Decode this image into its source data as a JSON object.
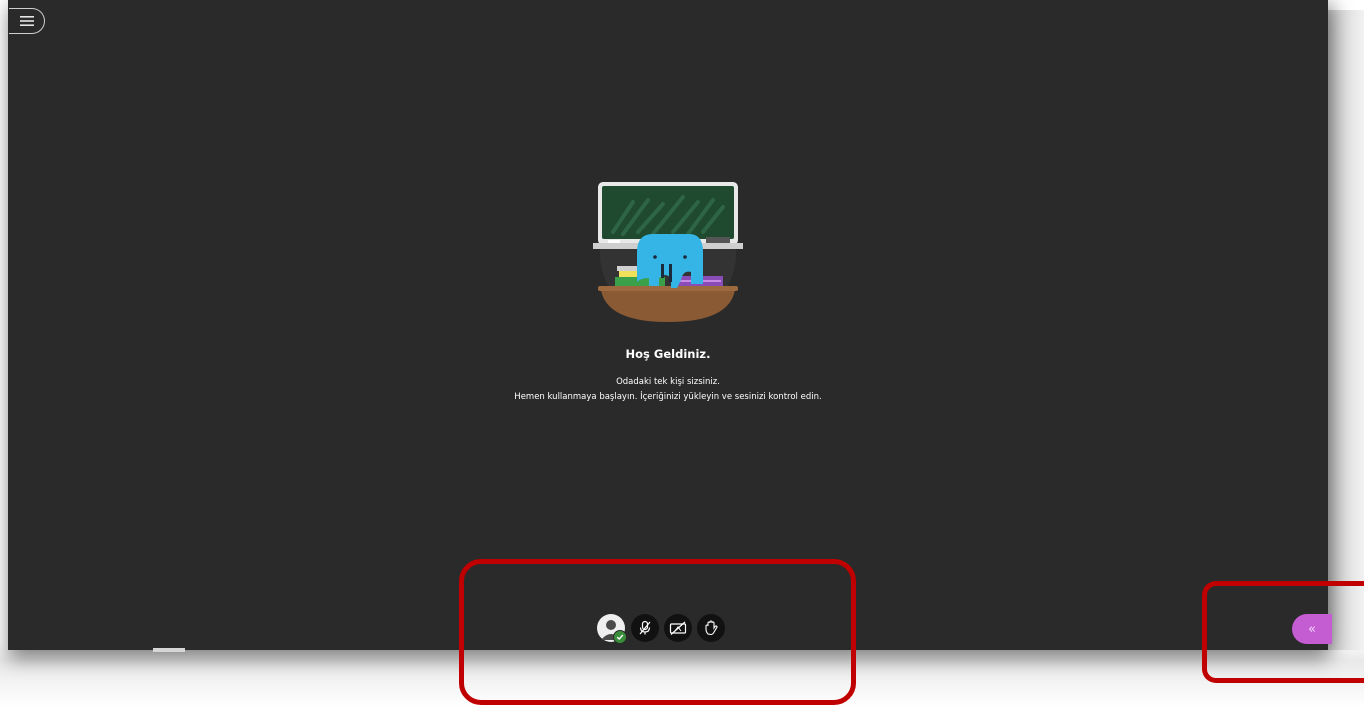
{
  "welcome": {
    "title": "Hoş Geldiniz.",
    "line1": "Odadaki tek kişi sizsiniz.",
    "line2": "Hemen kullanmaya başlayın. İçeriğinizi yükleyin ve sesinizi kontrol edin."
  },
  "controls": {
    "items": [
      {
        "icon": "avatar-icon",
        "status": "online"
      },
      {
        "icon": "microphone-muted-icon"
      },
      {
        "icon": "camera-off-icon"
      },
      {
        "icon": "raise-hand-icon"
      }
    ]
  },
  "collab_panel": {
    "icon": "double-chevron-left-icon",
    "label": "«"
  },
  "colors": {
    "stage_background": "#2a2a2a",
    "collab_accent": "#c45cd2",
    "status_ok": "#3a8e3a",
    "highlight": "#c00000"
  }
}
